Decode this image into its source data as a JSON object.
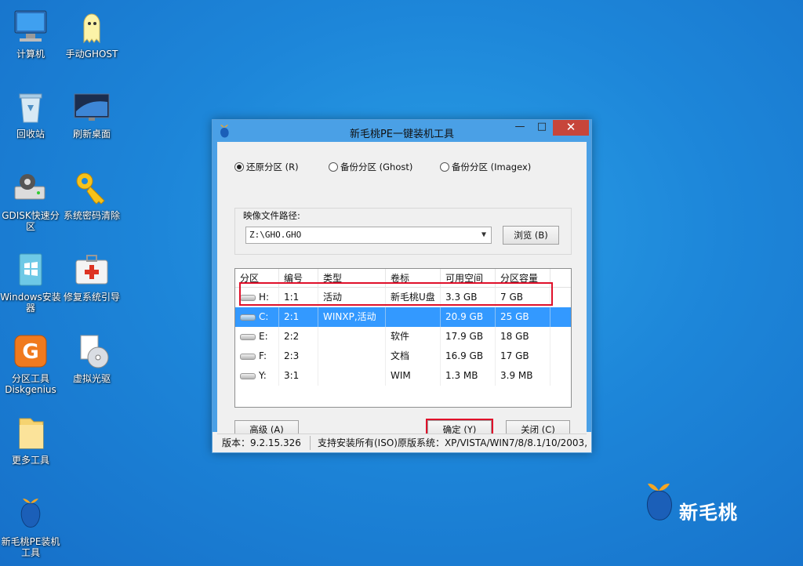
{
  "desktop": {
    "icons": [
      {
        "label": "计算机"
      },
      {
        "label": "手动GHOST"
      },
      {
        "label": "回收站"
      },
      {
        "label": "刷新桌面"
      },
      {
        "label": "GDISK快速分区"
      },
      {
        "label": "系统密码清除"
      },
      {
        "label": "Windows安装器"
      },
      {
        "label": "修复系统引导"
      },
      {
        "label": "分区工具Diskgenius"
      },
      {
        "label": "虚拟光驱"
      },
      {
        "label": "更多工具"
      },
      {
        "label": "新毛桃PE装机工具"
      }
    ],
    "brand": "新毛桃"
  },
  "window": {
    "title": "新毛桃PE一键装机工具",
    "minimize": "—",
    "maximize": "□",
    "close": "✕",
    "radio_restore": "还原分区 (R)",
    "radio_backup_ghost": "备份分区 (Ghost)",
    "radio_backup_imagex": "备份分区 (Imagex)",
    "image_path_label": "映像文件路径:",
    "image_path_value": "Z:\\GHO.GHO",
    "browse_button": "浏览 (B)",
    "table": {
      "headers": [
        "分区",
        "编号",
        "类型",
        "卷标",
        "可用空间",
        "分区容量"
      ],
      "rows": [
        {
          "part": "H:",
          "num": "1:1",
          "type": "活动",
          "label": "新毛桃U盘",
          "free": "3.3 GB",
          "size": "7 GB"
        },
        {
          "part": "C:",
          "num": "2:1",
          "type": "WINXP,活动",
          "label": "",
          "free": "20.9 GB",
          "size": "25 GB"
        },
        {
          "part": "E:",
          "num": "2:2",
          "type": "",
          "label": "软件",
          "free": "17.9 GB",
          "size": "18 GB"
        },
        {
          "part": "F:",
          "num": "2:3",
          "type": "",
          "label": "文档",
          "free": "16.9 GB",
          "size": "17 GB"
        },
        {
          "part": "Y:",
          "num": "3:1",
          "type": "",
          "label": "WIM",
          "free": "1.3 MB",
          "size": "3.9 MB"
        }
      ],
      "selected_index": 1
    },
    "advanced_button": "高级 (A)",
    "ok_button": "确定 (Y)",
    "close_button": "关闭 (C)",
    "status_version": "版本：9.2.15.326",
    "status_support": "支持安装所有(ISO)原版系统：XP/VISTA/WIN7/8/8.1/10/2003,"
  },
  "colors": {
    "accent": "#4aa0e6",
    "selection": "#3399ff",
    "highlight_box": "#e0102a"
  }
}
